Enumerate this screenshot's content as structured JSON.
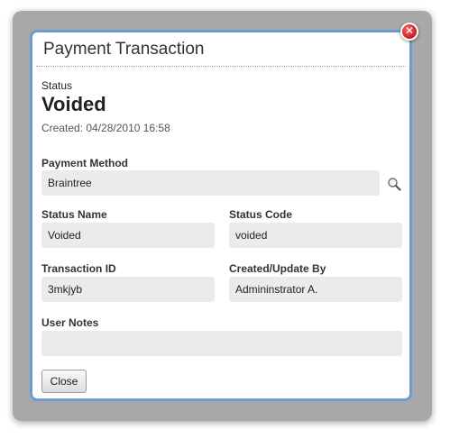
{
  "dialog": {
    "title": "Payment Transaction",
    "close_icon_glyph": "✕",
    "status_label": "Status",
    "status_value": "Voided",
    "created_text": "Created: 04/28/2010 16:58"
  },
  "fields": {
    "payment_method": {
      "label": "Payment Method",
      "value": "Braintree"
    },
    "status_name": {
      "label": "Status Name",
      "value": "Voided"
    },
    "status_code": {
      "label": "Status Code",
      "value": "voided"
    },
    "transaction_id": {
      "label": "Transaction ID",
      "value": "3mkjyb"
    },
    "created_update_by": {
      "label": "Created/Update By",
      "value": "Admininstrator A."
    },
    "user_notes": {
      "label": "User Notes",
      "value": ""
    }
  },
  "buttons": {
    "close_label": "Close"
  },
  "icons": {
    "lookup": "search-icon",
    "dismiss": "close-icon"
  },
  "colors": {
    "dialog_border": "#6a9bd1",
    "close_icon": "#c21b1b",
    "field_bg": "#ebebeb"
  }
}
